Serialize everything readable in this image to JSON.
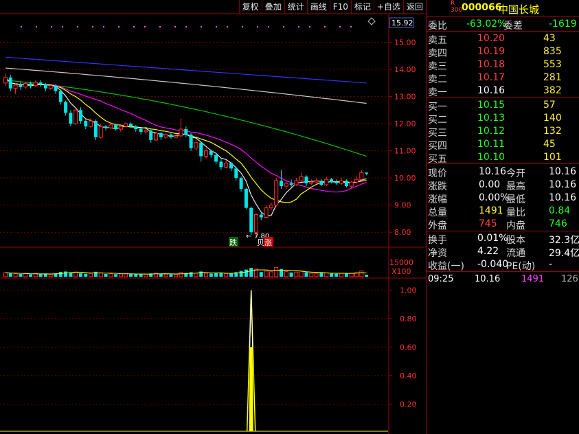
{
  "toolbar": {
    "buttons": [
      "复权",
      "叠加",
      "统计",
      "画线",
      "F10",
      "标记",
      "+自选",
      "返回"
    ]
  },
  "colors": {
    "up": "#ff3030",
    "down": "#00e5e5",
    "ma5": "#e8e8e8",
    "ma10": "#ffff00",
    "ma20": "#ff00ff",
    "ma60": "#00c000",
    "ma120": "#c8c8c8",
    "ma250": "#3333ff",
    "grid": "#7a0000",
    "axis_text": "#ff3030",
    "indicator": "#ffff00"
  },
  "price_axis": {
    "current_label": "15.92",
    "ticks": [
      "15.00",
      "14.00",
      "13.00",
      "12.00",
      "11.00",
      "10.00",
      "9.00",
      "8.00"
    ]
  },
  "volume_axis": {
    "label": "15000",
    "unit": "X100"
  },
  "indicator_axis": {
    "ticks": [
      "1.00",
      "0.80",
      "0.60",
      "0.40",
      "0.20"
    ]
  },
  "annotations": {
    "low_price": "7.80",
    "die_marker": "跌",
    "zhang_marker": "涨",
    "bei_marker": "贝"
  },
  "header": {
    "r_mark": "R",
    "board": "300",
    "code": "000066",
    "name": "中国长城"
  },
  "order_ratio": {
    "label": "委比",
    "value": "-63.02%",
    "diff_label": "委差",
    "diff": "-1619"
  },
  "sell_orders": [
    {
      "label": "卖五",
      "price": "10.20",
      "volume": "43"
    },
    {
      "label": "卖四",
      "price": "10.19",
      "volume": "835"
    },
    {
      "label": "卖三",
      "price": "10.18",
      "volume": "553"
    },
    {
      "label": "卖二",
      "price": "10.17",
      "volume": "281"
    },
    {
      "label": "卖一",
      "price": "10.16",
      "volume": "382"
    }
  ],
  "buy_orders": [
    {
      "label": "买一",
      "price": "10.15",
      "volume": "57"
    },
    {
      "label": "买二",
      "price": "10.13",
      "volume": "140"
    },
    {
      "label": "买三",
      "price": "10.12",
      "volume": "132"
    },
    {
      "label": "买四",
      "price": "10.11",
      "volume": "45"
    },
    {
      "label": "买五",
      "price": "10.10",
      "volume": "101"
    }
  ],
  "quote": [
    {
      "l1": "现价",
      "v1": "10.16",
      "l2": "今开",
      "v2": "10.16"
    },
    {
      "l1": "涨跌",
      "v1": "0.00",
      "l2": "最高",
      "v2": "10.16"
    },
    {
      "l1": "涨幅",
      "v1": "0.00%",
      "l2": "最低",
      "v2": "10.16"
    },
    {
      "l1": "总量",
      "v1": "1491",
      "l2": "量比",
      "v2": "0.84"
    },
    {
      "l1": "外盘",
      "v1": "745",
      "l2": "内盘",
      "v2": "746"
    }
  ],
  "fundamentals": [
    {
      "l1": "换手",
      "v1": "0.01%",
      "l2": "股本",
      "v2": "32.3亿"
    },
    {
      "l1": "净资",
      "v1": "4.22",
      "l2": "流通",
      "v2": "29.4亿"
    },
    {
      "l1": "收益(一)",
      "v1": "-0.040",
      "l2": "PE(动)",
      "v2": "-"
    }
  ],
  "tick": {
    "time": "09:25",
    "price": "10.16",
    "volume": "1491",
    "count": "126"
  },
  "chart_data": {
    "type": "candlestick",
    "ylim": [
      7.5,
      16.0
    ],
    "candles": [
      {
        "o": 13.5,
        "c": 13.7,
        "h": 13.85,
        "l": 13.4
      },
      {
        "o": 13.7,
        "c": 13.3,
        "h": 13.8,
        "l": 13.2
      },
      {
        "o": 13.3,
        "c": 13.42,
        "h": 13.5,
        "l": 13.1
      },
      {
        "o": 13.42,
        "c": 13.35,
        "h": 13.55,
        "l": 13.25
      },
      {
        "o": 13.35,
        "c": 13.48,
        "h": 13.55,
        "l": 13.3
      },
      {
        "o": 13.48,
        "c": 13.4,
        "h": 13.55,
        "l": 13.3
      },
      {
        "o": 13.4,
        "c": 13.52,
        "h": 13.6,
        "l": 13.35
      },
      {
        "o": 13.52,
        "c": 13.45,
        "h": 13.6,
        "l": 13.35
      },
      {
        "o": 13.45,
        "c": 13.3,
        "h": 13.5,
        "l": 13.2
      },
      {
        "o": 13.3,
        "c": 13.4,
        "h": 13.45,
        "l": 13.25
      },
      {
        "o": 13.4,
        "c": 13.2,
        "h": 13.45,
        "l": 13.1
      },
      {
        "o": 13.2,
        "c": 12.8,
        "h": 13.25,
        "l": 12.7
      },
      {
        "o": 12.8,
        "c": 12.4,
        "h": 12.85,
        "l": 12.3
      },
      {
        "o": 12.4,
        "c": 12.0,
        "h": 12.5,
        "l": 11.9
      },
      {
        "o": 12.0,
        "c": 12.5,
        "h": 12.6,
        "l": 11.95
      },
      {
        "o": 12.5,
        "c": 12.1,
        "h": 12.6,
        "l": 12.0
      },
      {
        "o": 12.1,
        "c": 11.9,
        "h": 12.2,
        "l": 11.8
      },
      {
        "o": 11.9,
        "c": 12.1,
        "h": 12.2,
        "l": 11.85
      },
      {
        "o": 12.1,
        "c": 11.5,
        "h": 12.15,
        "l": 11.4
      },
      {
        "o": 11.5,
        "c": 11.9,
        "h": 12.0,
        "l": 11.45
      },
      {
        "o": 11.9,
        "c": 11.85,
        "h": 11.95,
        "l": 11.75
      },
      {
        "o": 11.85,
        "c": 11.95,
        "h": 12.05,
        "l": 11.8
      },
      {
        "o": 11.95,
        "c": 11.8,
        "h": 12.0,
        "l": 11.75
      },
      {
        "o": 11.8,
        "c": 11.9,
        "h": 11.95,
        "l": 11.7
      },
      {
        "o": 11.9,
        "c": 12.0,
        "h": 12.05,
        "l": 11.85
      },
      {
        "o": 12.0,
        "c": 11.9,
        "h": 12.05,
        "l": 11.85
      },
      {
        "o": 11.9,
        "c": 11.8,
        "h": 11.95,
        "l": 11.7
      },
      {
        "o": 11.8,
        "c": 11.7,
        "h": 11.85,
        "l": 11.6
      },
      {
        "o": 11.7,
        "c": 11.75,
        "h": 11.8,
        "l": 11.6
      },
      {
        "o": 11.75,
        "c": 11.4,
        "h": 11.8,
        "l": 11.3
      },
      {
        "o": 11.4,
        "c": 11.65,
        "h": 11.7,
        "l": 11.35
      },
      {
        "o": 11.65,
        "c": 11.5,
        "h": 11.7,
        "l": 11.4
      },
      {
        "o": 11.5,
        "c": 11.6,
        "h": 11.65,
        "l": 11.45
      },
      {
        "o": 11.6,
        "c": 11.5,
        "h": 11.65,
        "l": 11.45
      },
      {
        "o": 11.5,
        "c": 11.55,
        "h": 11.6,
        "l": 11.45
      },
      {
        "o": 11.55,
        "c": 11.8,
        "h": 12.2,
        "l": 11.5
      },
      {
        "o": 11.8,
        "c": 11.6,
        "h": 11.9,
        "l": 11.5
      },
      {
        "o": 11.6,
        "c": 11.1,
        "h": 11.65,
        "l": 11.0
      },
      {
        "o": 11.1,
        "c": 11.3,
        "h": 11.4,
        "l": 11.0
      },
      {
        "o": 11.3,
        "c": 10.8,
        "h": 11.35,
        "l": 10.6
      },
      {
        "o": 10.8,
        "c": 11.0,
        "h": 11.1,
        "l": 10.7
      },
      {
        "o": 11.0,
        "c": 10.85,
        "h": 11.05,
        "l": 10.75
      },
      {
        "o": 10.85,
        "c": 10.6,
        "h": 10.9,
        "l": 10.5
      },
      {
        "o": 10.6,
        "c": 10.4,
        "h": 10.7,
        "l": 10.3
      },
      {
        "o": 10.4,
        "c": 10.55,
        "h": 10.65,
        "l": 10.35
      },
      {
        "o": 10.55,
        "c": 10.35,
        "h": 10.6,
        "l": 10.25
      },
      {
        "o": 10.35,
        "c": 10.0,
        "h": 10.4,
        "l": 9.9
      },
      {
        "o": 10.0,
        "c": 9.6,
        "h": 10.05,
        "l": 9.5
      },
      {
        "o": 9.6,
        "c": 8.9,
        "h": 9.65,
        "l": 8.85
      },
      {
        "o": 8.9,
        "c": 8.0,
        "h": 8.95,
        "l": 7.9
      },
      {
        "o": 8.0,
        "c": 8.65,
        "h": 8.7,
        "l": 7.8
      },
      {
        "o": 8.65,
        "c": 8.55,
        "h": 8.75,
        "l": 8.45
      },
      {
        "o": 8.55,
        "c": 8.9,
        "h": 9.0,
        "l": 8.5
      },
      {
        "o": 8.9,
        "c": 9.0,
        "h": 9.1,
        "l": 8.8
      },
      {
        "o": 9.0,
        "c": 9.9,
        "h": 10.0,
        "l": 8.95
      },
      {
        "o": 9.9,
        "c": 9.7,
        "h": 10.3,
        "l": 9.6
      },
      {
        "o": 9.7,
        "c": 9.8,
        "h": 9.9,
        "l": 9.6
      },
      {
        "o": 9.8,
        "c": 9.75,
        "h": 9.95,
        "l": 9.65
      },
      {
        "o": 9.75,
        "c": 9.9,
        "h": 10.0,
        "l": 9.7
      },
      {
        "o": 9.9,
        "c": 10.05,
        "h": 10.2,
        "l": 9.85
      },
      {
        "o": 10.05,
        "c": 9.8,
        "h": 10.1,
        "l": 9.7
      },
      {
        "o": 9.8,
        "c": 9.85,
        "h": 9.95,
        "l": 9.75
      },
      {
        "o": 9.85,
        "c": 9.9,
        "h": 10.0,
        "l": 9.8
      },
      {
        "o": 9.9,
        "c": 9.75,
        "h": 9.95,
        "l": 9.7
      },
      {
        "o": 9.75,
        "c": 9.95,
        "h": 10.05,
        "l": 9.7
      },
      {
        "o": 9.95,
        "c": 9.85,
        "h": 10.0,
        "l": 9.8
      },
      {
        "o": 9.85,
        "c": 9.8,
        "h": 9.95,
        "l": 9.75
      },
      {
        "o": 9.8,
        "c": 9.9,
        "h": 10.0,
        "l": 9.75
      },
      {
        "o": 9.9,
        "c": 9.7,
        "h": 9.95,
        "l": 9.65
      },
      {
        "o": 9.7,
        "c": 9.85,
        "h": 9.9,
        "l": 9.6
      },
      {
        "o": 9.85,
        "c": 9.95,
        "h": 10.05,
        "l": 9.8
      },
      {
        "o": 9.95,
        "c": 10.2,
        "h": 10.3,
        "l": 9.9
      },
      {
        "o": 10.2,
        "c": 10.16,
        "h": 10.2,
        "l": 10.1
      }
    ],
    "volume": [
      3000,
      2500,
      2300,
      2000,
      2200,
      1800,
      2400,
      1900,
      2100,
      1800,
      2600,
      3500,
      3800,
      3200,
      3400,
      2600,
      2200,
      2400,
      3600,
      2900,
      2000,
      2200,
      1900,
      2100,
      2300,
      2000,
      1800,
      1700,
      1900,
      2400,
      2600,
      2100,
      1900,
      1800,
      1700,
      3000,
      2800,
      3300,
      2500,
      3800,
      2600,
      2300,
      2800,
      2700,
      2300,
      2400,
      3300,
      4200,
      5200,
      6500,
      5600,
      3400,
      4100,
      3600,
      6800,
      5600,
      3800,
      3100,
      3400,
      4300,
      3300,
      2600,
      2500,
      2800,
      2900,
      2400,
      2200,
      2400,
      2700,
      2600,
      3000,
      4200,
      1491
    ],
    "indicator": {
      "peak_index": 49,
      "peak_value": 1.0,
      "mid_value": 0.6
    }
  }
}
